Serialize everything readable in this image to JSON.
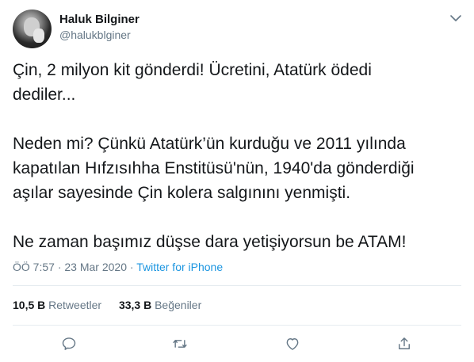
{
  "author": {
    "display_name": "Haluk Bilginer",
    "handle": "@halukblginer"
  },
  "tweet": {
    "lines_p1": [
      "Çin, 2 milyon kit gönderdi! Ücretini, Atatürk ödedi",
      "dediler..."
    ],
    "lines_p2": [
      "Neden mi? Çünkü Atatürk’ün kurduğu ve 2011 yılında",
      "kapatılan Hıfzısıhha Enstitüsü'nün, 1940'da gönderdiği",
      "aşılar sayesinde Çin kolera salgınını yenmişti."
    ],
    "lines_p3": [
      "Ne zaman başımız düşse dara yetişiyorsun be ATAM!"
    ]
  },
  "meta": {
    "time": "ÖÖ 7:57",
    "separator": "·",
    "date": "23 Mar 2020",
    "source": "Twitter for iPhone"
  },
  "stats": {
    "retweets_count": "10,5 B",
    "retweets_label": "Retweetler",
    "likes_count": "33,3 B",
    "likes_label": "Beğeniler"
  },
  "icons": {
    "caret": "chevron-down-icon",
    "reply": "reply-icon",
    "retweet": "retweet-icon",
    "like": "heart-icon",
    "share": "share-icon"
  },
  "colors": {
    "text": "#14171a",
    "secondary": "#657786",
    "link": "#1b95e0",
    "divider": "#e6ecf0"
  }
}
